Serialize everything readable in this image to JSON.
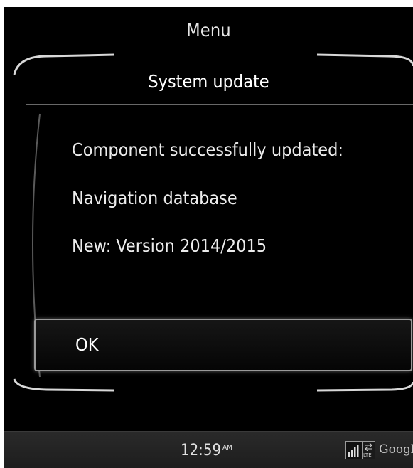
{
  "header": {
    "menu_title": "Menu",
    "page_title": "System update"
  },
  "content": {
    "line1": "Component successfully updated:",
    "line2": "Navigation database",
    "line3": "New: Version 2014/2015"
  },
  "actions": {
    "ok_label": "OK"
  },
  "status_bar": {
    "time": "12:59",
    "time_suffix": "AM",
    "network_icon": "signal-bars-icon",
    "network_badge": "LTE",
    "provider": "Google"
  },
  "colors": {
    "background": "#000000",
    "text": "#ececec",
    "frame": "#9a9a9a",
    "status_bar": "#242424"
  }
}
